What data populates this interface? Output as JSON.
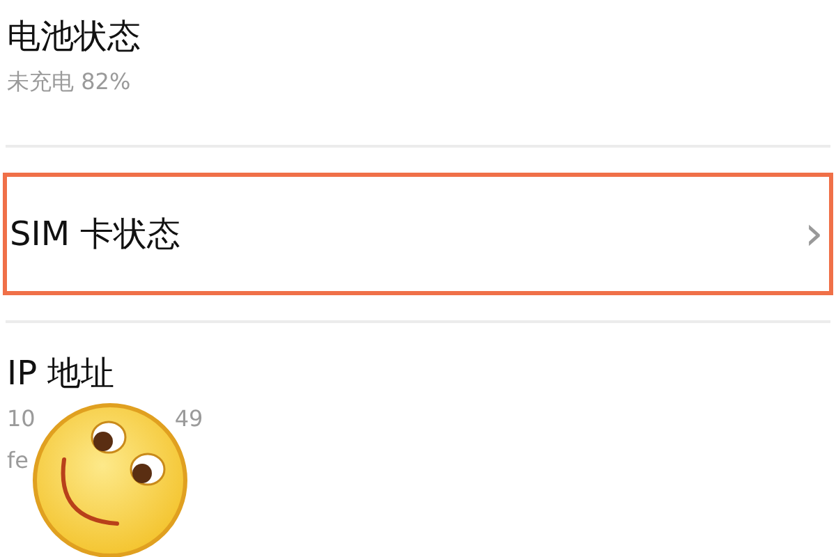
{
  "items": [
    {
      "kind": "info",
      "title": "电池状态",
      "lines": [
        [
          "未充电 82%"
        ]
      ],
      "highlighted": false
    },
    {
      "kind": "link",
      "title": "SIM 卡状态",
      "chevron": "›",
      "highlighted": true
    },
    {
      "kind": "info",
      "title": "IP 地址",
      "lines": [
        [
          "10",
          "49"
        ],
        [
          "fe"
        ]
      ],
      "highlighted": false
    }
  ],
  "sticker": {
    "kind": "smiley"
  }
}
